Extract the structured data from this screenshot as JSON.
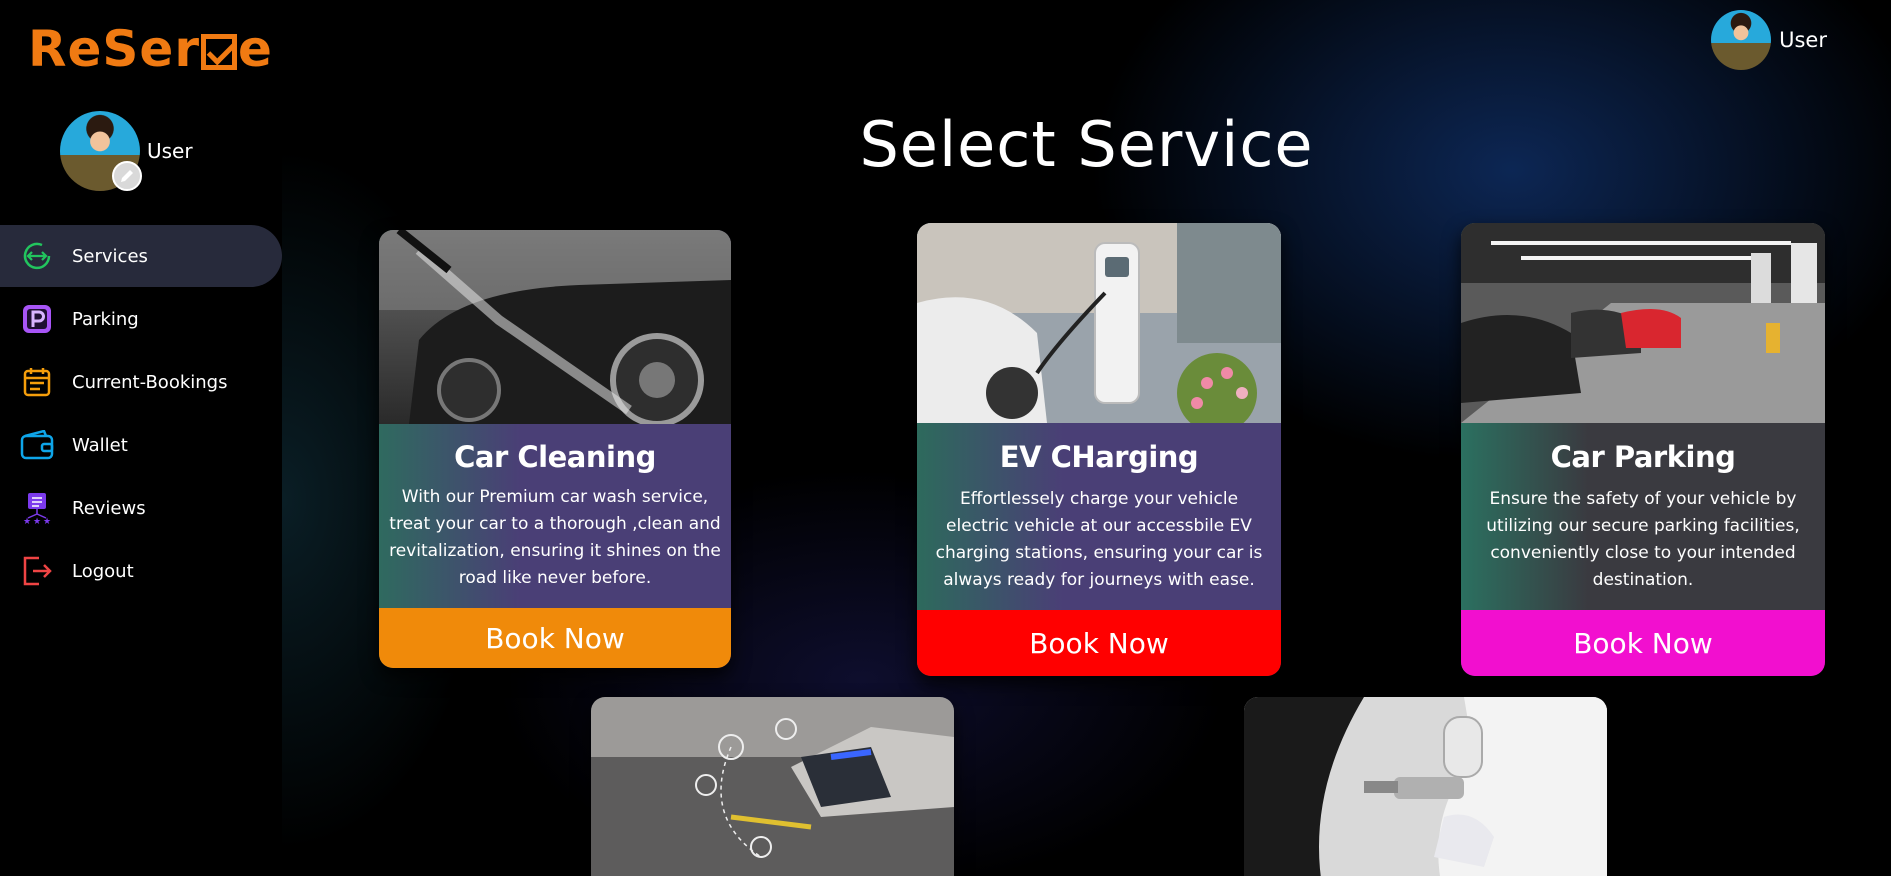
{
  "brand": {
    "logo_text_pre": "ReSer",
    "logo_text_post": "e"
  },
  "sidebar": {
    "profile_name": "User",
    "items": [
      {
        "label": "Services",
        "icon": "services-icon",
        "color": "#22c55e",
        "active": true
      },
      {
        "label": "Parking",
        "icon": "parking-icon",
        "color": "#a855f7"
      },
      {
        "label": "Current-Bookings",
        "icon": "calendar-icon",
        "color": "#f59e0b"
      },
      {
        "label": "Wallet",
        "icon": "wallet-icon",
        "color": "#0ea5e9"
      },
      {
        "label": "Reviews",
        "icon": "reviews-icon",
        "color": "#7c3aed"
      },
      {
        "label": "Logout",
        "icon": "logout-icon",
        "color": "#ef4444"
      }
    ]
  },
  "header": {
    "user_name": "User"
  },
  "page": {
    "title": "Select Service"
  },
  "services": [
    {
      "title": "Car Cleaning",
      "description": "With our Premium car wash service, treat your car to a thorough ,clean and revitalization, ensuring it shines on the road like never before.",
      "button": "Book Now",
      "button_color": "#f08a0a"
    },
    {
      "title": "EV CHarging",
      "description": "Effortlessely charge your vehicle electric vehicle at our accessbile EV charging stations, ensuring your car is always ready for journeys with ease.",
      "button": "Book Now",
      "button_color": "#ff0000"
    },
    {
      "title": "Car Parking",
      "description": "Ensure the safety of your vehicle by utilizing our secure parking facilities, conveniently close to your intended destination.",
      "button": "Book Now",
      "button_color": "#f20fcf"
    }
  ]
}
